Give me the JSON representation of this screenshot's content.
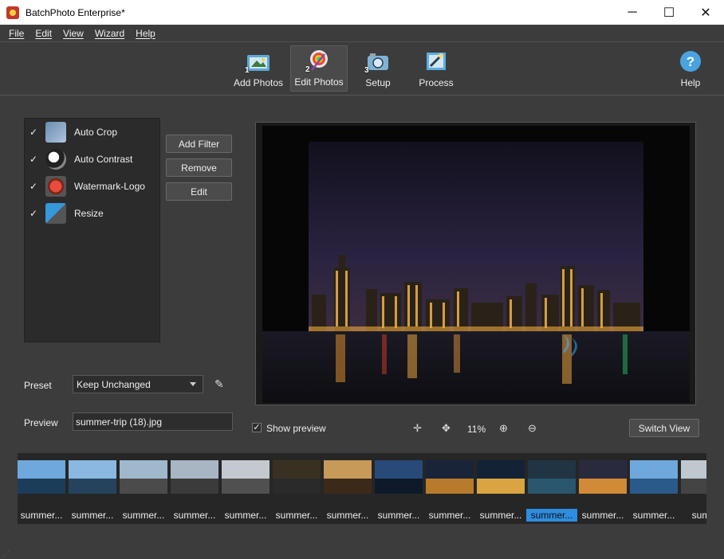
{
  "window": {
    "title": "BatchPhoto Enterprise*",
    "minimize": "─",
    "maximize": "☐",
    "close": "✕"
  },
  "menu": [
    "File",
    "Edit",
    "View",
    "Wizard",
    "Help"
  ],
  "toolbar": {
    "steps": [
      {
        "label": "Add Photos",
        "num": "1"
      },
      {
        "label": "Edit Photos",
        "num": "2"
      },
      {
        "label": "Setup",
        "num": "3"
      },
      {
        "label": "Process",
        "num": ""
      }
    ],
    "help": "Help"
  },
  "filters": [
    {
      "label": "Auto Crop",
      "checked": true
    },
    {
      "label": "Auto Contrast",
      "checked": true
    },
    {
      "label": "Watermark-Logo",
      "checked": true
    },
    {
      "label": "Resize",
      "checked": true
    }
  ],
  "buttons": {
    "add_filter": "Add Filter",
    "remove": "Remove",
    "edit": "Edit",
    "switch_view": "Switch View"
  },
  "preset": {
    "label": "Preset",
    "value": "Keep Unchanged"
  },
  "preview": {
    "label": "Preview",
    "value": "summer-trip (18).jpg"
  },
  "show_preview": {
    "label": "Show preview",
    "checked": true
  },
  "zoom": "11%",
  "thumbnails": [
    "summer...",
    "summer...",
    "summer...",
    "summer...",
    "summer...",
    "summer...",
    "summer...",
    "summer...",
    "summer...",
    "summer...",
    "summer...",
    "summer...",
    "summer...",
    "summ"
  ],
  "selected_thumbnail": 10,
  "colors": {
    "accent": "#2e8de0",
    "background": "#3c3c3c",
    "panel": "#2b2b2b"
  }
}
